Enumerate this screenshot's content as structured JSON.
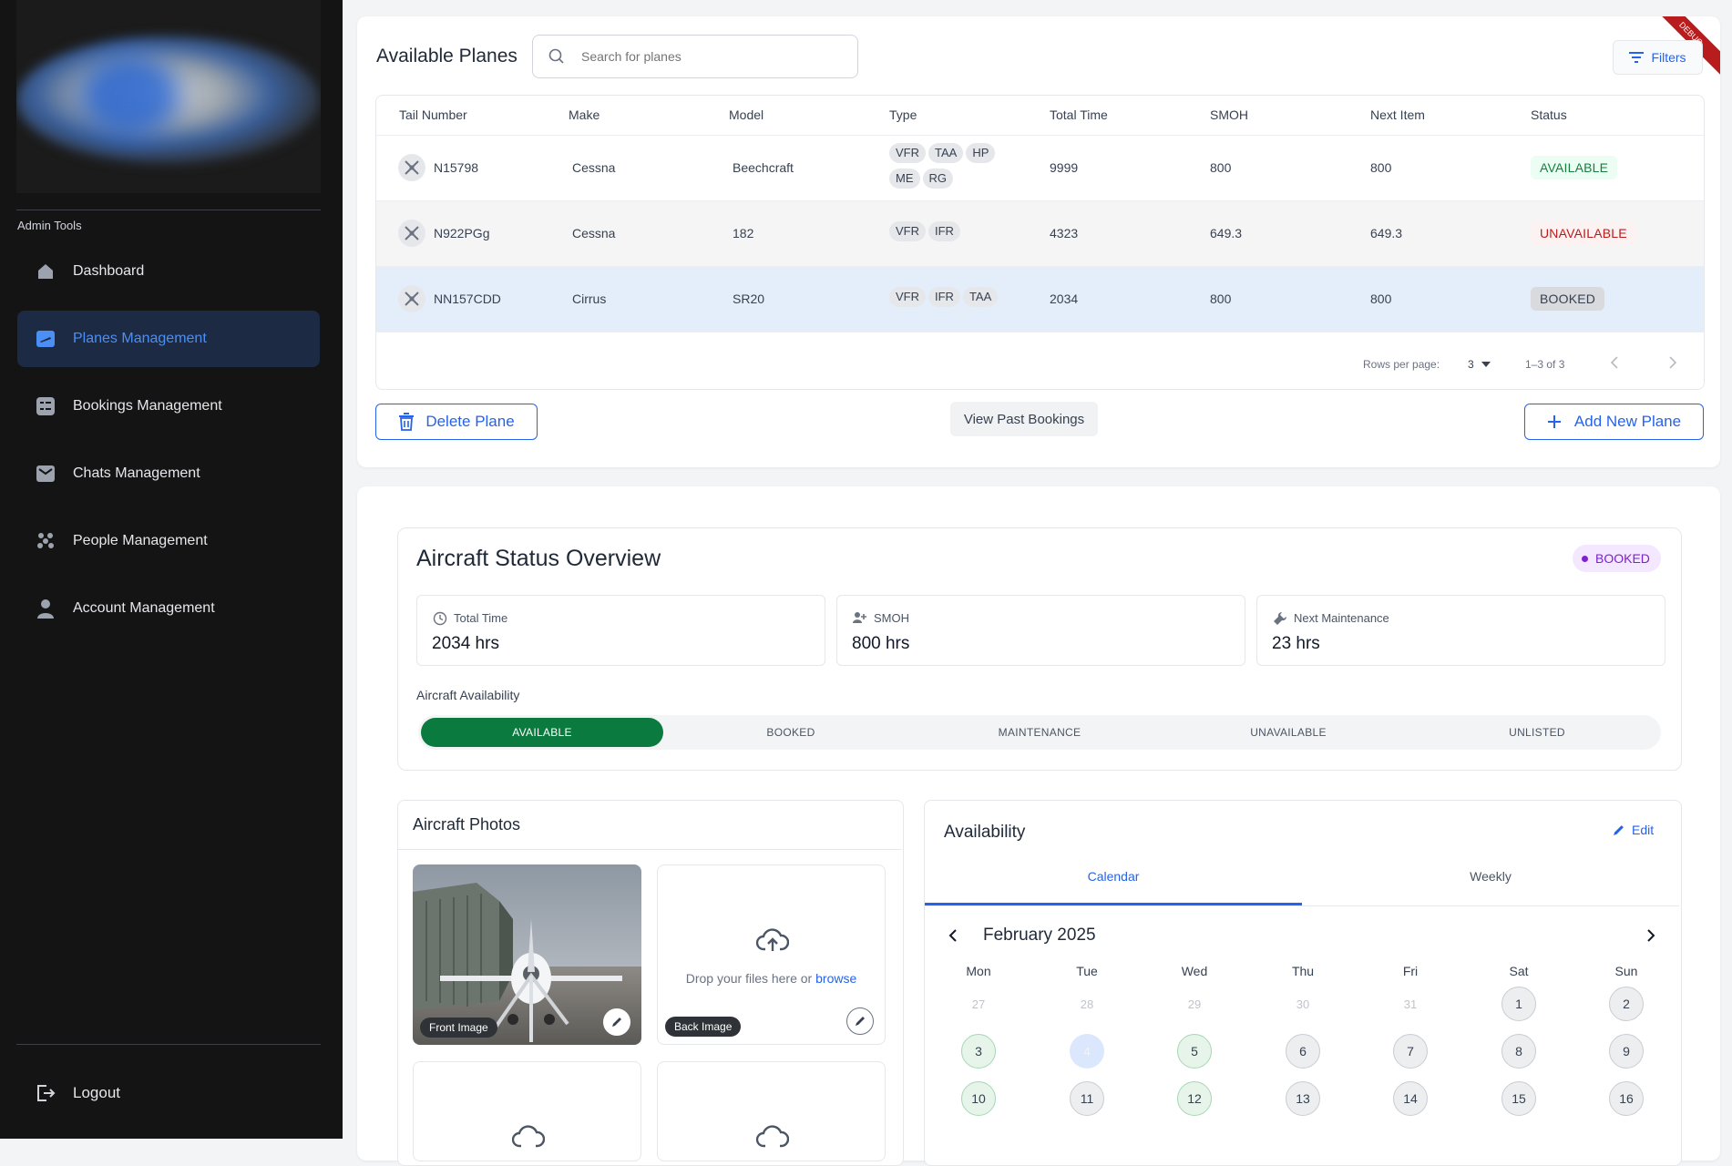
{
  "sidebar": {
    "section_label": "Admin Tools",
    "items": [
      {
        "label": "Dashboard",
        "icon": "home-icon"
      },
      {
        "label": "Planes Management",
        "icon": "planes-icon"
      },
      {
        "label": "Bookings Management",
        "icon": "bookings-icon"
      },
      {
        "label": "Chats Management",
        "icon": "chat-icon"
      },
      {
        "label": "People Management",
        "icon": "people-icon"
      },
      {
        "label": "Account Management",
        "icon": "account-icon"
      }
    ],
    "logout_label": "Logout"
  },
  "debug_banner": "DEBUG",
  "planes": {
    "title": "Available Planes",
    "search_placeholder": "Search for planes",
    "filters_label": "Filters",
    "columns": [
      "Tail Number",
      "Make",
      "Model",
      "Type",
      "Total Time",
      "SMOH",
      "Next Item",
      "Status"
    ],
    "rows": [
      {
        "tail": "N15798",
        "make": "Cessna",
        "model": "Beechcraft",
        "types": [
          "VFR",
          "TAA",
          "HP",
          "ME",
          "RG"
        ],
        "total_time": "9999",
        "smoh": "800",
        "next_item": "800",
        "status": "AVAILABLE"
      },
      {
        "tail": "N922PGg",
        "make": "Cessna",
        "model": "182",
        "types": [
          "VFR",
          "IFR"
        ],
        "total_time": "4323",
        "smoh": "649.3",
        "next_item": "649.3",
        "status": "UNAVAILABLE"
      },
      {
        "tail": "NN157CDD",
        "make": "Cirrus",
        "model": "SR20",
        "types": [
          "VFR",
          "IFR",
          "TAA"
        ],
        "total_time": "2034",
        "smoh": "800",
        "next_item": "800",
        "status": "BOOKED"
      }
    ],
    "pagination": {
      "rows_per_page_label": "Rows per page:",
      "rows_per_page": "3",
      "range": "1–3 of 3"
    },
    "delete_label": "Delete Plane",
    "past_bookings_label": "View Past Bookings",
    "add_label": "Add New Plane"
  },
  "overview": {
    "title": "Aircraft Status Overview",
    "badge": "BOOKED",
    "stats": [
      {
        "label": "Total Time",
        "value": "2034 hrs",
        "icon": "clock-icon"
      },
      {
        "label": "SMOH",
        "value": "800 hrs",
        "icon": "engine-icon"
      },
      {
        "label": "Next Maintenance",
        "value": "23 hrs",
        "icon": "wrench-icon"
      }
    ],
    "availability_label": "Aircraft Availability",
    "availability_options": [
      "AVAILABLE",
      "BOOKED",
      "MAINTENANCE",
      "UNAVAILABLE",
      "UNLISTED"
    ],
    "availability_selected": "AVAILABLE"
  },
  "photos": {
    "title": "Aircraft Photos",
    "front_label": "Front Image",
    "back_label": "Back Image",
    "drop_text": "Drop your files here or",
    "browse_text": "browse"
  },
  "availability": {
    "title": "Availability",
    "edit_label": "Edit",
    "tabs": [
      "Calendar",
      "Weekly"
    ],
    "active_tab": "Calendar",
    "month": "February 2025",
    "weekdays": [
      "Mon",
      "Tue",
      "Wed",
      "Thu",
      "Fri",
      "Sat",
      "Sun"
    ],
    "days": [
      {
        "d": "27",
        "state": "outside"
      },
      {
        "d": "28",
        "state": "outside"
      },
      {
        "d": "29",
        "state": "outside"
      },
      {
        "d": "30",
        "state": "outside"
      },
      {
        "d": "31",
        "state": "outside"
      },
      {
        "d": "1",
        "state": "normal"
      },
      {
        "d": "2",
        "state": "normal"
      },
      {
        "d": "3",
        "state": "available"
      },
      {
        "d": "4",
        "state": "today"
      },
      {
        "d": "5",
        "state": "available"
      },
      {
        "d": "6",
        "state": "normal"
      },
      {
        "d": "7",
        "state": "normal"
      },
      {
        "d": "8",
        "state": "normal"
      },
      {
        "d": "9",
        "state": "normal"
      },
      {
        "d": "10",
        "state": "available"
      },
      {
        "d": "11",
        "state": "normal"
      },
      {
        "d": "12",
        "state": "available"
      },
      {
        "d": "13",
        "state": "normal"
      },
      {
        "d": "14",
        "state": "normal"
      },
      {
        "d": "15",
        "state": "normal"
      },
      {
        "d": "16",
        "state": "normal"
      }
    ]
  },
  "colors": {
    "accent": "#2563eb",
    "available": "#0b7a3e",
    "sidebar": "#141414"
  }
}
